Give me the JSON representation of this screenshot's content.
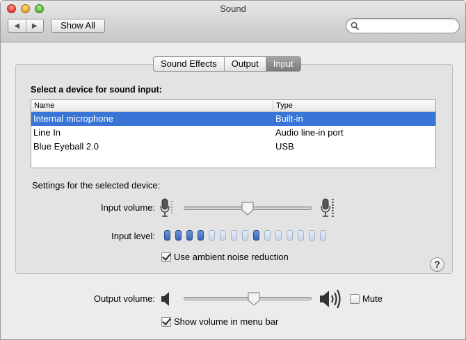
{
  "window": {
    "title": "Sound"
  },
  "toolbar": {
    "back_icon": "chevron-left-icon",
    "forward_icon": "chevron-right-icon",
    "show_all_label": "Show All",
    "search_placeholder": "",
    "search_icon": "magnifier-icon"
  },
  "tabs": [
    {
      "label": "Sound Effects",
      "selected": false
    },
    {
      "label": "Output",
      "selected": false
    },
    {
      "label": "Input",
      "selected": true
    }
  ],
  "input_panel": {
    "heading": "Select a device for sound input:",
    "columns": [
      "Name",
      "Type"
    ],
    "devices": [
      {
        "name": "Internal microphone",
        "type": "Built-in",
        "selected": true
      },
      {
        "name": "Line In",
        "type": "Audio line-in port",
        "selected": false
      },
      {
        "name": "Blue Eyeball 2.0",
        "type": "USB",
        "selected": false
      }
    ],
    "settings_label": "Settings for the selected device:",
    "input_volume_label": "Input volume:",
    "input_volume_value": 0.5,
    "input_level_label": "Input level:",
    "input_level_segments": 15,
    "input_level_active": [
      0,
      1,
      2,
      3,
      8
    ],
    "ambient_label": "Use ambient noise reduction",
    "ambient_checked": true,
    "help_label": "?"
  },
  "footer": {
    "output_volume_label": "Output volume:",
    "output_volume_value": 0.55,
    "mute_label": "Mute",
    "mute_checked": false,
    "show_volume_label": "Show volume in menu bar",
    "show_volume_checked": true
  },
  "colors": {
    "selection": "#3875d7",
    "level_on": "#3a66b3",
    "level_off": "#c8d6e8"
  }
}
